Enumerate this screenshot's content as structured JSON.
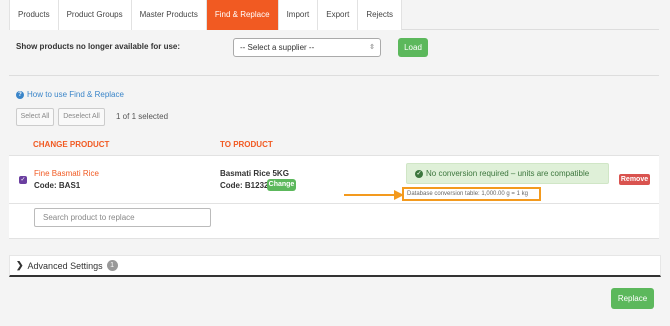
{
  "tabs": [
    {
      "label": "Products",
      "active": false
    },
    {
      "label": "Product Groups",
      "active": false
    },
    {
      "label": "Master Products",
      "active": false
    },
    {
      "label": "Find & Replace",
      "active": true
    },
    {
      "label": "Import",
      "active": false
    },
    {
      "label": "Export",
      "active": false
    },
    {
      "label": "Rejects",
      "active": false
    }
  ],
  "supplier": {
    "label": "Show products no longer available for use:",
    "select_value": "-- Select a supplier --",
    "load_label": "Load"
  },
  "help": {
    "link_text": "How to use Find & Replace",
    "icon": "question-circle-icon"
  },
  "selection": {
    "select_all": "Select All",
    "deselect_all": "Deselect All",
    "count_text": "1 of 1 selected"
  },
  "columns": {
    "change": "CHANGE PRODUCT",
    "to": "TO PRODUCT"
  },
  "rows": [
    {
      "checked": true,
      "from_name": "Fine Basmati Rice",
      "from_code": "Code: BAS1",
      "to_name": "Basmati Rice 5KG",
      "to_code": "Code: B1232",
      "change_label": "Change",
      "conversion_message": "No conversion required – units are compatible",
      "db_note": "Database conversion table: 1,000.00 g = 1 kg",
      "remove_label": "Remove"
    }
  ],
  "search": {
    "placeholder": "Search product to replace"
  },
  "advanced": {
    "label": "Advanced Settings",
    "count": "1"
  },
  "actions": {
    "replace_label": "Replace"
  },
  "colors": {
    "accent": "#f15a22",
    "success": "#5cb85c",
    "danger": "#d9534f",
    "highlight": "#f39a1e",
    "link": "#3a85c9"
  }
}
